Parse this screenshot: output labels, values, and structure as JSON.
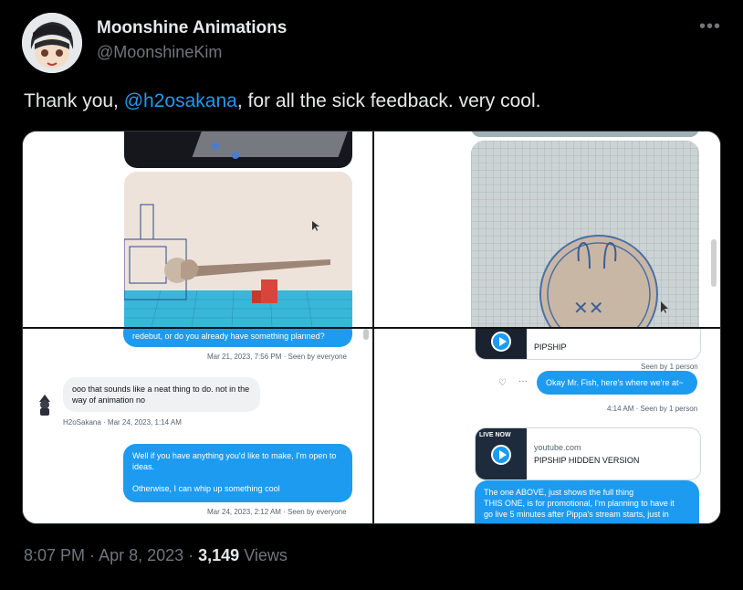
{
  "author": {
    "name": "Moonshine Animations",
    "handle": "@MoonshineKim"
  },
  "tweet": {
    "text_before": "Thank you, ",
    "mention": "@h2osakana",
    "text_after": ", for all the sick feedback. very cool.",
    "more_icon": "more-horizontal-icon"
  },
  "media": {
    "q3": {
      "msg1_tail": "redebut, or do you already have something planned?",
      "msg1_meta": "Mar 21, 2023, 7:56 PM · Seen by everyone",
      "msg2_text": "ooo that sounds like a neat thing to do. not in the way of animation no",
      "msg2_meta": "H2oSakana · Mar 24, 2023, 1:14 AM",
      "msg3_p1": "Well if you have anything you'd like to make, I'm open to ideas.",
      "msg3_p2": "Otherwise, I can whip up something cool",
      "msg3_meta": "Mar 24, 2023, 2:12 AM · Seen by everyone"
    },
    "q4": {
      "card1_title": "PIPSHIP",
      "card1_meta": "Seen by 1 person",
      "msg_text": "Okay Mr. Fish, here's where we're at~",
      "msg_meta": "4:14 AM · Seen by 1 person",
      "card2_thumb": "LIVE NOW",
      "card2_domain": "youtube.com",
      "card2_title": "PIPSHIP HIDDEN VERSION",
      "msg2_l1": "The one ABOVE, just shows the full thing",
      "msg2_l2": "THIS ONE, is for promotional, I'm planning to have it",
      "msg2_l3": "go live 5 minutes after Pippa's stream starts, just in"
    }
  },
  "footer": {
    "time": "8:07 PM",
    "sep1": " · ",
    "date": "Apr 8, 2023",
    "sep2": " · ",
    "views_count": "3,149",
    "views_label": " Views"
  },
  "colors": {
    "accent": "#1d9bf0",
    "background": "#000000",
    "text": "#e7e9ea",
    "muted": "#71767b"
  }
}
